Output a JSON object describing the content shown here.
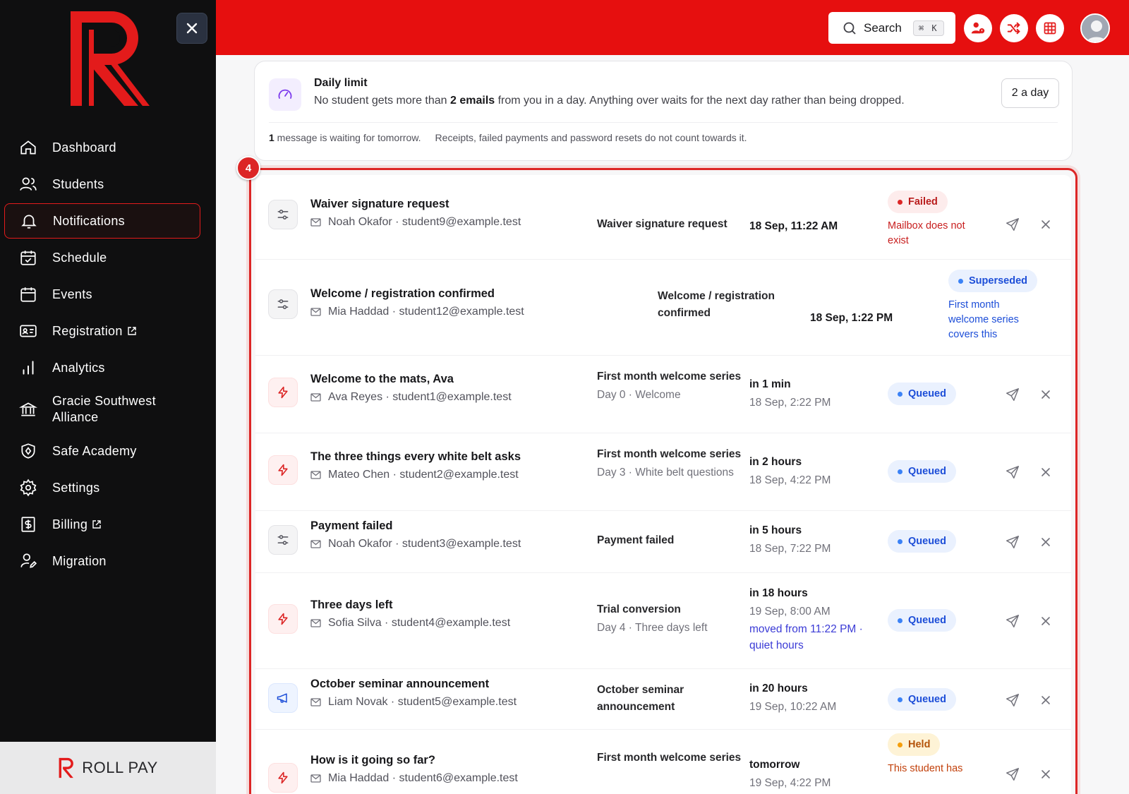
{
  "sidebar": {
    "close_icon": "close-icon",
    "items": [
      {
        "label": "Dashboard",
        "icon": "home-icon"
      },
      {
        "label": "Students",
        "icon": "users-icon"
      },
      {
        "label": "Notifications",
        "icon": "bell-icon"
      },
      {
        "label": "Schedule",
        "icon": "calendar-check-icon"
      },
      {
        "label": "Events",
        "icon": "calendar-icon"
      },
      {
        "label": "Registration",
        "icon": "id-card-icon"
      },
      {
        "label": "Analytics",
        "icon": "bar-chart-icon"
      },
      {
        "label": "Gracie Southwest Alliance",
        "icon": "bank-icon"
      },
      {
        "label": "Safe Academy",
        "icon": "shield-icon"
      },
      {
        "label": "Settings",
        "icon": "gear-icon"
      },
      {
        "label": "Billing",
        "icon": "dollar-receipt-icon"
      },
      {
        "label": "Migration",
        "icon": "user-edit-icon"
      }
    ],
    "footer_brand": "ROLL PAY"
  },
  "topbar": {
    "search_label": "Search",
    "search_shortcut": "⌘ K",
    "accent": "#e60f0f"
  },
  "daily_limit": {
    "title": "Daily limit",
    "desc_pre": "No student gets more than ",
    "desc_bold": "2 emails",
    "desc_post": " from you in a day. Anything over waits for the next day rather than being dropped.",
    "selected": "2 a day",
    "waiting_count": "1",
    "waiting_text": " message is waiting for tomorrow.",
    "exclusion_note": "Receipts, failed payments and password resets do not count towards it."
  },
  "list": {
    "badge": "4",
    "rows": [
      {
        "icon": "sliders-icon",
        "title": "Waiver signature request",
        "to": "Noah Okafor · student9@example.test",
        "template": "Waiver signature request",
        "template_sub": "",
        "when1": "18 Sep, 11:22 AM",
        "when2": "",
        "when3": "",
        "status": "Failed",
        "status_kind": "failed",
        "note": "Mailbox does not exist"
      },
      {
        "icon": "sliders-icon",
        "title": "Welcome / registration confirmed",
        "to": "Mia Haddad · student12@example.test",
        "template": "Welcome / registration confirmed",
        "template_sub": "",
        "when1": "18 Sep, 1:22 PM",
        "when2": "",
        "when3": "",
        "status": "Superseded",
        "status_kind": "blue",
        "note": "First month welcome series covers this"
      },
      {
        "icon": "bolt-icon",
        "title": "Welcome to the mats, Ava",
        "to": "Ava Reyes · student1@example.test",
        "template": "First month welcome series",
        "template_sub": "Day 0 · Welcome",
        "when1": "in 1 min",
        "when2": "18 Sep, 2:22 PM",
        "when3": "",
        "status": "Queued",
        "status_kind": "blue",
        "note": ""
      },
      {
        "icon": "bolt-icon",
        "title": "The three things every white belt asks",
        "to": "Mateo Chen · student2@example.test",
        "template": "First month welcome series",
        "template_sub": "Day 3 · White belt questions",
        "when1": "in 2 hours",
        "when2": "18 Sep, 4:22 PM",
        "when3": "",
        "status": "Queued",
        "status_kind": "blue",
        "note": ""
      },
      {
        "icon": "sliders-icon",
        "title": "Payment failed",
        "to": "Noah Okafor · student3@example.test",
        "template": "Payment failed",
        "template_sub": "",
        "when1": "in 5 hours",
        "when2": "18 Sep, 7:22 PM",
        "when3": "",
        "status": "Queued",
        "status_kind": "blue",
        "note": ""
      },
      {
        "icon": "bolt-icon",
        "title": "Three days left",
        "to": "Sofia Silva · student4@example.test",
        "template": "Trial conversion",
        "template_sub": "Day 4 · Three days left",
        "when1": "in 18 hours",
        "when2": "19 Sep, 8:00 AM",
        "when3": "moved from 11:22 PM · quiet hours",
        "status": "Queued",
        "status_kind": "blue",
        "note": ""
      },
      {
        "icon": "megaphone-icon",
        "title": "October seminar announcement",
        "to": "Liam Novak · student5@example.test",
        "template": "October seminar announcement",
        "template_sub": "",
        "when1": "in 20 hours",
        "when2": "19 Sep, 10:22 AM",
        "when3": "",
        "status": "Queued",
        "status_kind": "blue",
        "note": ""
      },
      {
        "icon": "bolt-icon",
        "title": "How is it going so far?",
        "to": "Mia Haddad · student6@example.test",
        "template": "First month welcome series",
        "template_sub": "",
        "when1": "tomorrow",
        "when2": "19 Sep, 4:22 PM",
        "when3": "",
        "status": "Held",
        "status_kind": "held",
        "note": "This student has"
      }
    ]
  }
}
